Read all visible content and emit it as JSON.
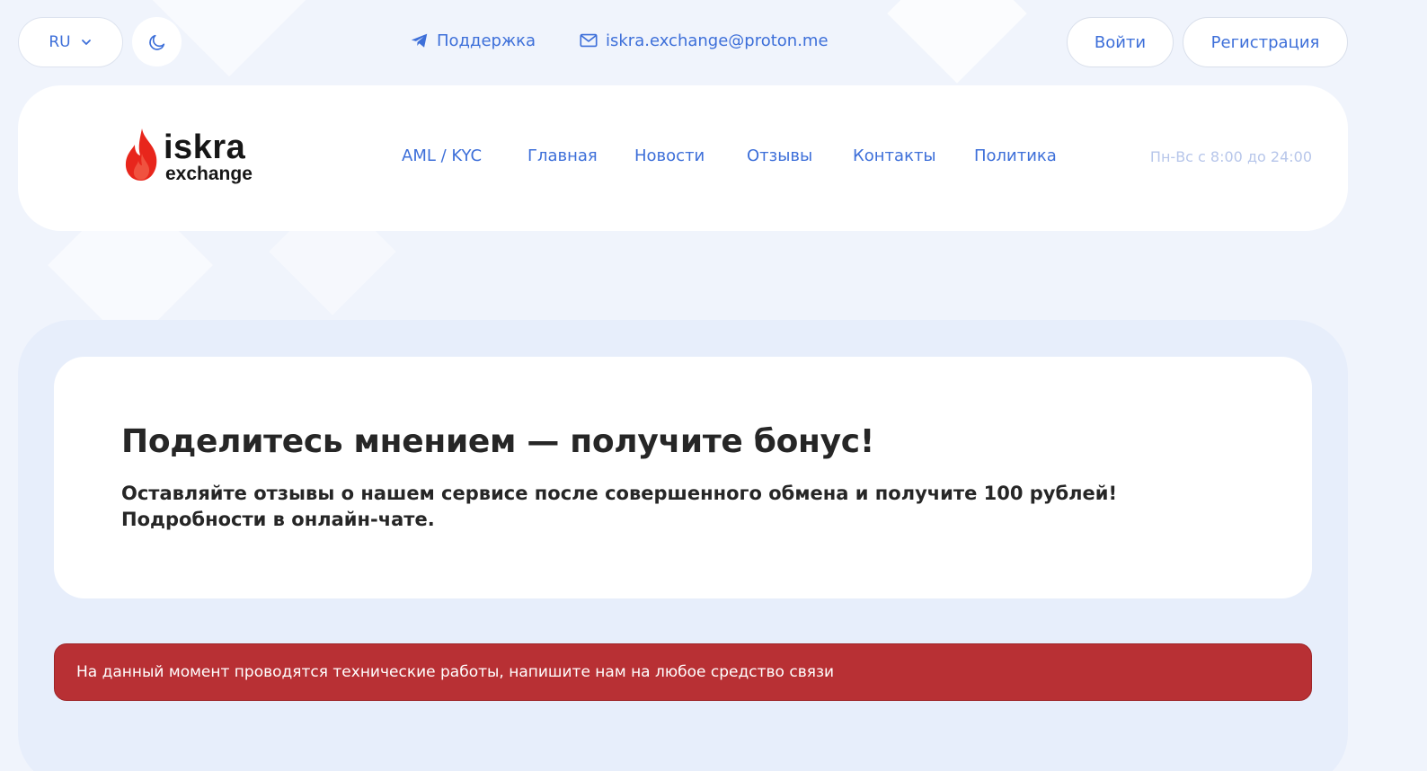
{
  "topbar": {
    "language": "RU",
    "support_label": "Поддержка",
    "email": "iskra.exchange@proton.me",
    "login_label": "Войти",
    "register_label": "Регистрация"
  },
  "header": {
    "logo_line1": "iskra",
    "logo_line2": "exchange",
    "nav": [
      "AML / KYC",
      "Главная",
      "Новости",
      "Отзывы",
      "Контакты",
      "Политика"
    ],
    "hours": "Пн-Вс с 8:00 до 24:00"
  },
  "promo": {
    "title": "Поделитесь мнением — получите бонус!",
    "text_line1": "Оставляйте отзывы о нашем сервисе после совершенного обмена и получите 100 рублей!",
    "text_line2": "Подробности в онлайн-чате."
  },
  "alert": {
    "text": "На данный момент проводятся технические работы, напишите нам на любое средство связи"
  },
  "colors": {
    "accent": "#3d6fd9",
    "background": "#f0f4fc",
    "alert": "#b83034",
    "flame": "#e8261c"
  },
  "icons": {
    "language_chevron": "chevron-down-icon",
    "theme": "moon-icon",
    "support": "telegram-icon",
    "email": "mail-icon",
    "logo": "flame-icon"
  }
}
